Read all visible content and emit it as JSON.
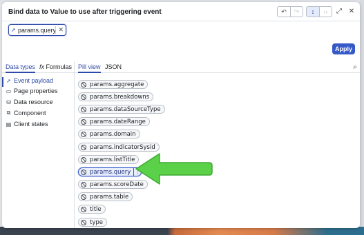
{
  "dialog": {
    "title": "Bind data to Value to use after triggering event",
    "apply_label": "Apply"
  },
  "header_buttons": {
    "undo_icon": "undo-icon",
    "redo_icon": "redo-icon",
    "sort_icon": "sort-icon",
    "code_icon": "code-icon",
    "expand_icon": "expand-icon",
    "close_icon": "close-icon"
  },
  "binding": {
    "value": "params.query"
  },
  "tabs": {
    "data_types": "Data types",
    "formulas": "Formulas",
    "pill_view": "Pill view",
    "json": "JSON"
  },
  "sidebar": {
    "items": [
      {
        "label": "Event payload",
        "icon": "cursor-icon",
        "active": true
      },
      {
        "label": "Page properties",
        "icon": "page-icon",
        "active": false
      },
      {
        "label": "Data resource",
        "icon": "database-icon",
        "active": false
      },
      {
        "label": "Component",
        "icon": "component-icon",
        "active": false
      },
      {
        "label": "Client states",
        "icon": "client-state-icon",
        "active": false
      }
    ]
  },
  "pills": [
    {
      "label": "params.aggregate",
      "selected": false
    },
    {
      "label": "params.breakdowns",
      "selected": false
    },
    {
      "label": "params.dataSourceType",
      "selected": false
    },
    {
      "label": "params.dateRange",
      "selected": false
    },
    {
      "label": "params.domain",
      "selected": false
    },
    {
      "label": "params.indicatorSysid",
      "selected": false
    },
    {
      "label": "params.listTitle",
      "selected": false
    },
    {
      "label": "params.query",
      "selected": true
    },
    {
      "label": "params.scoreDate",
      "selected": false
    },
    {
      "label": "params.table",
      "selected": false
    },
    {
      "label": "title",
      "selected": false
    },
    {
      "label": "type",
      "selected": false
    }
  ],
  "colors": {
    "accent": "#3559c7",
    "arrow": "#5bd14a"
  }
}
